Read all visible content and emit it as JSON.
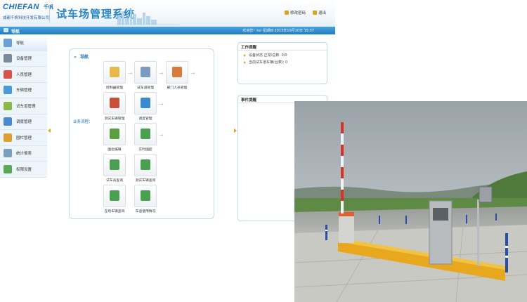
{
  "header": {
    "brand": "CHIEFAN",
    "brand_cn": "千帆",
    "company": "成都千帆科技开发有限公司",
    "system_title": "试车场管理系统",
    "change_password": "修改密码",
    "logout": "退出"
  },
  "navbar": {
    "title": "导航",
    "welcome": "欢迎您！ter 星期四 2013年10月10日 15:37"
  },
  "sidebar": {
    "items": [
      {
        "label": "导航",
        "icon": "compass-icon",
        "color": "#6aa0d8"
      },
      {
        "label": "设备管理",
        "icon": "device-icon",
        "color": "#7a8a9a"
      },
      {
        "label": "人员管理",
        "icon": "people-icon",
        "color": "#d8524a"
      },
      {
        "label": "车辆管理",
        "icon": "vehicle-icon",
        "color": "#4a9ad8"
      },
      {
        "label": "试车道管理",
        "icon": "track-icon",
        "color": "#8ab84a"
      },
      {
        "label": "调度管理",
        "icon": "schedule-icon",
        "color": "#4a8ad0"
      },
      {
        "label": "围栏管理",
        "icon": "fence-icon",
        "color": "#e0a030"
      },
      {
        "label": "统计报表",
        "icon": "report-icon",
        "color": "#7aa0c0"
      },
      {
        "label": "权限设置",
        "icon": "permission-icon",
        "color": "#58a858"
      }
    ]
  },
  "workflow": {
    "title": "导航",
    "business_label": "业务流程：",
    "tiles": [
      {
        "label": "控制器管理",
        "icon": "controller-icon",
        "color": "#e8b84a"
      },
      {
        "label": "试车道管理",
        "icon": "track-edit-icon",
        "color": "#7a9ac0"
      },
      {
        "label": "部门人员管理",
        "icon": "department-icon",
        "color": "#d87a3a"
      },
      {
        "label": "测试车辆管理",
        "icon": "test-vehicle-icon",
        "color": "#c8503a"
      },
      {
        "label": "调度管理",
        "icon": "dispatch-icon",
        "color": "#3a8ad0"
      },
      {
        "label": "围栏编辑",
        "icon": "fence-edit-icon",
        "color": "#5aa040"
      },
      {
        "label": "实时围控",
        "icon": "realtime-icon",
        "color": "#4aa050"
      },
      {
        "label": "试车员查询",
        "icon": "driver-query-icon",
        "color": "#4aa050"
      },
      {
        "label": "测试车辆查询",
        "icon": "vehicle-query-icon",
        "color": "#4aa050"
      },
      {
        "label": "在场车辆查询",
        "icon": "onsite-query-icon",
        "color": "#4aa050"
      },
      {
        "label": "车道使用情况",
        "icon": "lane-usage-icon",
        "color": "#4aa050"
      }
    ]
  },
  "work_reminder": {
    "title": "工作提醒",
    "items": [
      {
        "text": "设备状态 正常/总数: 0/0"
      },
      {
        "text": "当前试车道车辆(台数): 0"
      }
    ]
  },
  "event_reminder": {
    "title": "事件提醒"
  },
  "colors": {
    "accent": "#1f7cc2",
    "brand": "#1a6fb8",
    "arrow": "#e8a020"
  }
}
